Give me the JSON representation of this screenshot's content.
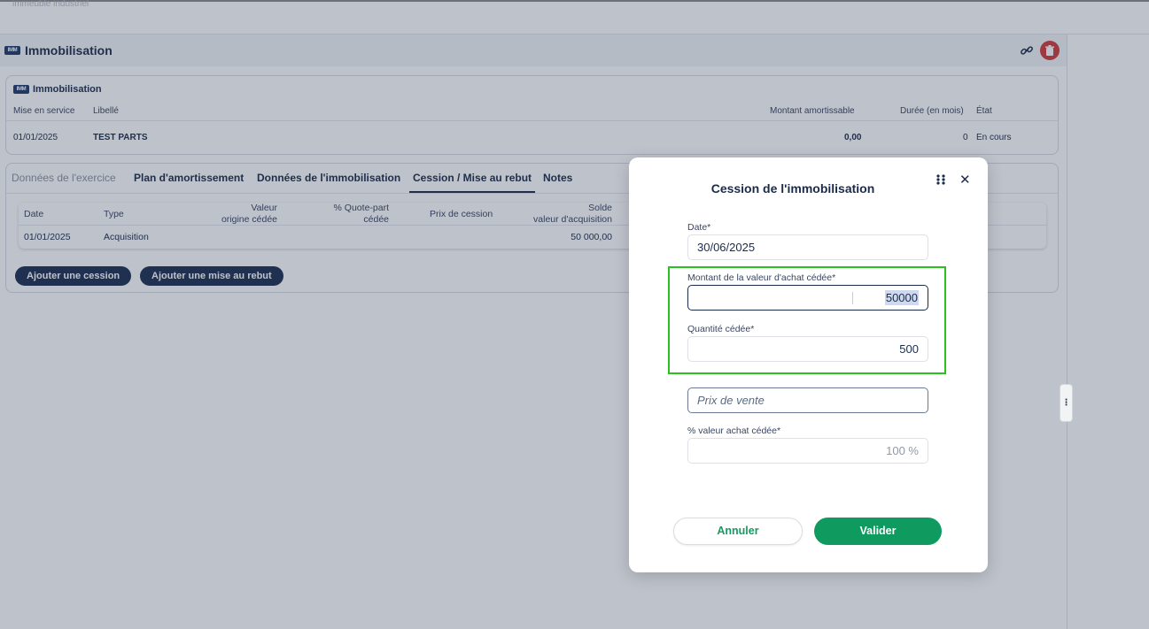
{
  "topbar": {
    "ghost_text": "immeuble industriel"
  },
  "page": {
    "badge": "IMM",
    "title": "Immobilisation",
    "icons": [
      "link-icon",
      "delete-icon"
    ]
  },
  "summary": {
    "title": "Immobilisation",
    "headers": {
      "mise_en_service": "Mise en service",
      "libelle": "Libellé",
      "montant": "Montant amortissable",
      "duree": "Durée (en mois)",
      "etat": "État"
    },
    "row": {
      "mise_en_service": "01/01/2025",
      "libelle": "TEST PARTS",
      "montant": "0,00",
      "duree": "0",
      "etat": "En cours"
    }
  },
  "tabs": [
    {
      "label": "Données de l'exercice"
    },
    {
      "label": "Plan d'amortissement"
    },
    {
      "label": "Données de l'immobilisation"
    },
    {
      "label": "Cession / Mise au rebut"
    },
    {
      "label": "Notes"
    }
  ],
  "cession_table": {
    "headers": {
      "date": "Date",
      "type": "Type",
      "valeur_1": "Valeur",
      "valeur_2": "origine cédée",
      "quote_1": "% Quote-part",
      "quote_2": "cédée",
      "prix": "Prix de cession",
      "solde_1": "Solde",
      "solde_2": "valeur d'acquisition"
    },
    "row": {
      "date": "01/01/2025",
      "type": "Acquisition",
      "solde": "50 000,00"
    }
  },
  "actions": {
    "add_cession": "Ajouter une cession",
    "add_rebut": "Ajouter une mise au rebut"
  },
  "modal": {
    "title": "Cession de l'immobilisation",
    "date_label": "Date*",
    "date_value": "30/06/2025",
    "montant_label": "Montant de la valeur d'achat cédée*",
    "montant_value": "50000",
    "quantite_label": "Quantité cédée*",
    "quantite_value": "500",
    "prix_placeholder": "Prix de vente",
    "pct_label": "% valeur achat cédée*",
    "pct_value": "100 %",
    "cancel": "Annuler",
    "validate": "Valider"
  },
  "colors": {
    "primary_dark": "#1c2f52",
    "success": "#0f9a60",
    "danger": "#d23b3b",
    "highlight": "#29c21f"
  }
}
